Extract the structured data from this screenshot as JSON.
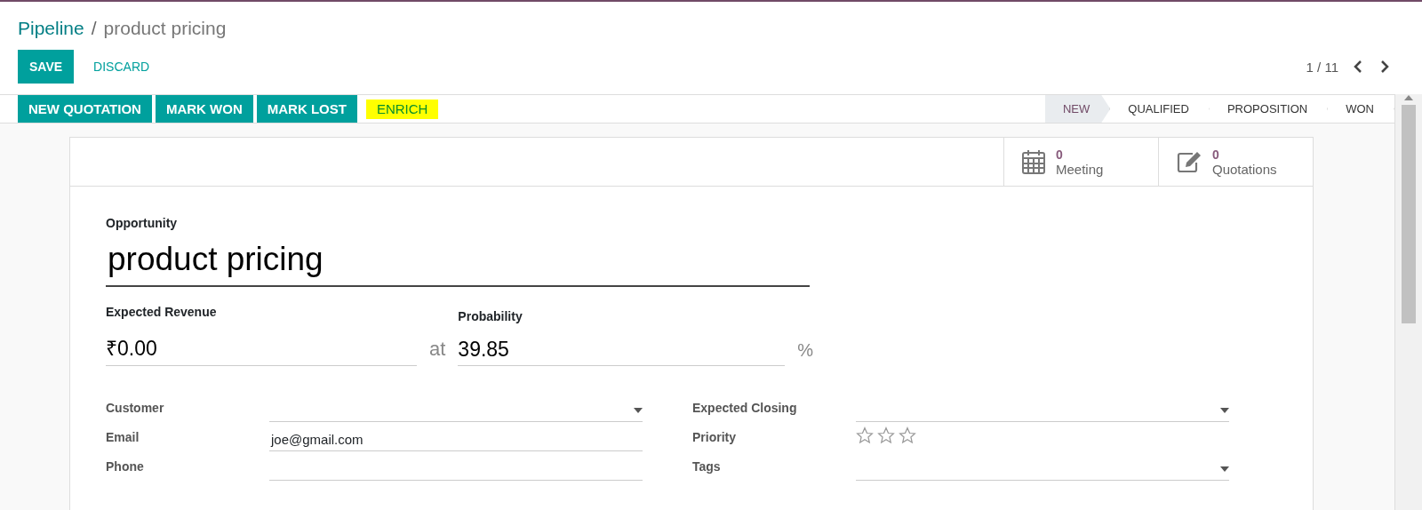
{
  "breadcrumb": {
    "parent": "Pipeline",
    "separator": "/",
    "current": "product pricing"
  },
  "control_buttons": {
    "save": "SAVE",
    "discard": "DISCARD"
  },
  "pager": {
    "value": "1 / 11"
  },
  "actions": [
    {
      "label": "NEW QUOTATION",
      "kind": "button"
    },
    {
      "label": "MARK WON",
      "kind": "button"
    },
    {
      "label": "MARK LOST",
      "kind": "button"
    },
    {
      "label": "ENRICH",
      "kind": "highlight"
    }
  ],
  "stages": [
    {
      "label": "NEW",
      "selected": true
    },
    {
      "label": "QUALIFIED",
      "selected": false
    },
    {
      "label": "PROPOSITION",
      "selected": false
    },
    {
      "label": "WON",
      "selected": false
    }
  ],
  "smart_buttons": [
    {
      "kind": "calendar",
      "count": "0",
      "label": "Meeting"
    },
    {
      "kind": "edit",
      "count": "0",
      "label": "Quotations"
    }
  ],
  "form": {
    "title_label": "Opportunity",
    "title": "product pricing",
    "revenue": {
      "label": "Expected Revenue",
      "value": "₹0.00"
    },
    "at": "at",
    "probability": {
      "label": "Probability",
      "value": "39.85",
      "unit": "%"
    },
    "left_fields": [
      {
        "label": "Customer",
        "kind": "select"
      },
      {
        "label": "Email",
        "value": "joe@gmail.com",
        "kind": "text"
      },
      {
        "label": "Phone",
        "kind": "text"
      }
    ],
    "right_fields": [
      {
        "label": "Expected Closing",
        "kind": "select"
      },
      {
        "label": "Priority",
        "kind": "stars",
        "stars": 0
      },
      {
        "label": "Tags",
        "kind": "select"
      }
    ]
  }
}
